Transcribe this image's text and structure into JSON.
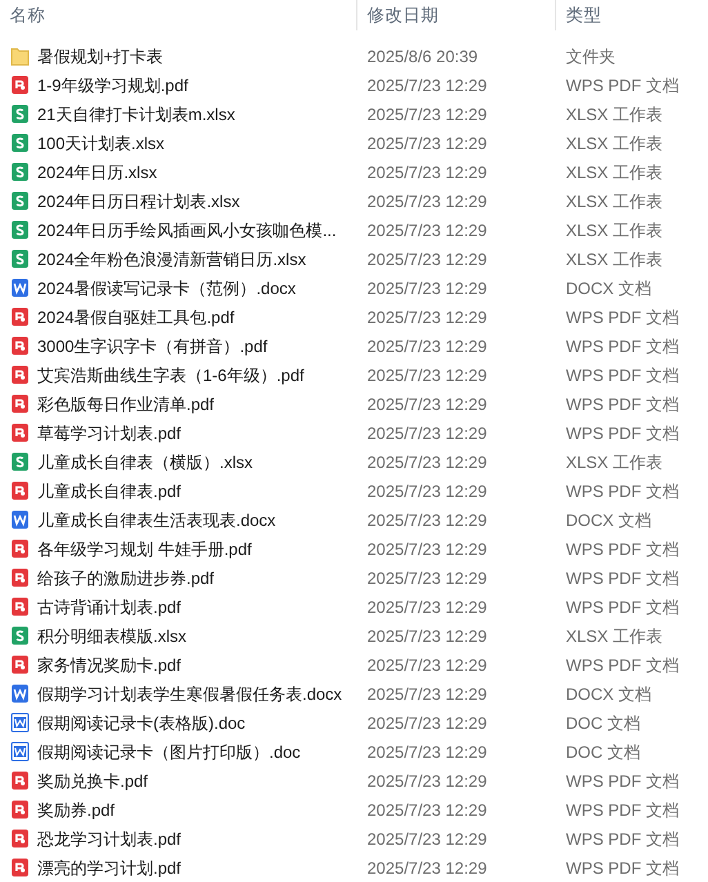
{
  "columns": [
    {
      "label": "名称"
    },
    {
      "label": "修改日期"
    },
    {
      "label": "类型"
    }
  ],
  "rows": [
    {
      "kind": "folder",
      "name": "暑假规划+打卡表",
      "date": "2025/8/6 20:39",
      "type": "文件夹"
    },
    {
      "kind": "pdf",
      "name": "1-9年级学习规划.pdf",
      "date": "2025/7/23 12:29",
      "type": "WPS PDF 文档"
    },
    {
      "kind": "xlsx",
      "name": "21天自律打卡计划表m.xlsx",
      "date": "2025/7/23 12:29",
      "type": "XLSX 工作表"
    },
    {
      "kind": "xlsx",
      "name": "100天计划表.xlsx",
      "date": "2025/7/23 12:29",
      "type": "XLSX 工作表"
    },
    {
      "kind": "xlsx",
      "name": "2024年日历.xlsx",
      "date": "2025/7/23 12:29",
      "type": "XLSX 工作表"
    },
    {
      "kind": "xlsx",
      "name": "2024年日历日程计划表.xlsx",
      "date": "2025/7/23 12:29",
      "type": "XLSX 工作表"
    },
    {
      "kind": "xlsx",
      "name": "2024年日历手绘风插画风小女孩咖色模...",
      "date": "2025/7/23 12:29",
      "type": "XLSX 工作表"
    },
    {
      "kind": "xlsx",
      "name": "2024全年粉色浪漫清新营销日历.xlsx",
      "date": "2025/7/23 12:29",
      "type": "XLSX 工作表"
    },
    {
      "kind": "docx",
      "name": "2024暑假读写记录卡（范例）.docx",
      "date": "2025/7/23 12:29",
      "type": "DOCX 文档"
    },
    {
      "kind": "pdf",
      "name": "2024暑假自驱娃工具包.pdf",
      "date": "2025/7/23 12:29",
      "type": "WPS PDF 文档"
    },
    {
      "kind": "pdf",
      "name": "3000生字识字卡（有拼音）.pdf",
      "date": "2025/7/23 12:29",
      "type": "WPS PDF 文档"
    },
    {
      "kind": "pdf",
      "name": "艾宾浩斯曲线生字表（1-6年级）.pdf",
      "date": "2025/7/23 12:29",
      "type": "WPS PDF 文档"
    },
    {
      "kind": "pdf",
      "name": "彩色版每日作业清单.pdf",
      "date": "2025/7/23 12:29",
      "type": "WPS PDF 文档"
    },
    {
      "kind": "pdf",
      "name": "草莓学习计划表.pdf",
      "date": "2025/7/23 12:29",
      "type": "WPS PDF 文档"
    },
    {
      "kind": "xlsx",
      "name": "儿童成长自律表（横版）.xlsx",
      "date": "2025/7/23 12:29",
      "type": "XLSX 工作表"
    },
    {
      "kind": "pdf",
      "name": "儿童成长自律表.pdf",
      "date": "2025/7/23 12:29",
      "type": "WPS PDF 文档"
    },
    {
      "kind": "docx",
      "name": "儿童成长自律表生活表现表.docx",
      "date": "2025/7/23 12:29",
      "type": "DOCX 文档"
    },
    {
      "kind": "pdf",
      "name": "各年级学习规划 牛娃手册.pdf",
      "date": "2025/7/23 12:29",
      "type": "WPS PDF 文档"
    },
    {
      "kind": "pdf",
      "name": "给孩子的激励进步券.pdf",
      "date": "2025/7/23 12:29",
      "type": "WPS PDF 文档"
    },
    {
      "kind": "pdf",
      "name": "古诗背诵计划表.pdf",
      "date": "2025/7/23 12:29",
      "type": "WPS PDF 文档"
    },
    {
      "kind": "xlsx",
      "name": "积分明细表模版.xlsx",
      "date": "2025/7/23 12:29",
      "type": "XLSX 工作表"
    },
    {
      "kind": "pdf",
      "name": "家务情况奖励卡.pdf",
      "date": "2025/7/23 12:29",
      "type": "WPS PDF 文档"
    },
    {
      "kind": "docx",
      "name": "假期学习计划表学生寒假暑假任务表.docx",
      "date": "2025/7/23 12:29",
      "type": "DOCX 文档"
    },
    {
      "kind": "doc",
      "name": "假期阅读记录卡(表格版).doc",
      "date": "2025/7/23 12:29",
      "type": "DOC 文档"
    },
    {
      "kind": "doc",
      "name": "假期阅读记录卡（图片打印版）.doc",
      "date": "2025/7/23 12:29",
      "type": "DOC 文档"
    },
    {
      "kind": "pdf",
      "name": "奖励兑换卡.pdf",
      "date": "2025/7/23 12:29",
      "type": "WPS PDF 文档"
    },
    {
      "kind": "pdf",
      "name": "奖励券.pdf",
      "date": "2025/7/23 12:29",
      "type": "WPS PDF 文档"
    },
    {
      "kind": "pdf",
      "name": "恐龙学习计划表.pdf",
      "date": "2025/7/23 12:29",
      "type": "WPS PDF 文档"
    },
    {
      "kind": "pdf",
      "name": "漂亮的学习计划.pdf",
      "date": "2025/7/23 12:29",
      "type": "WPS PDF 文档"
    }
  ]
}
